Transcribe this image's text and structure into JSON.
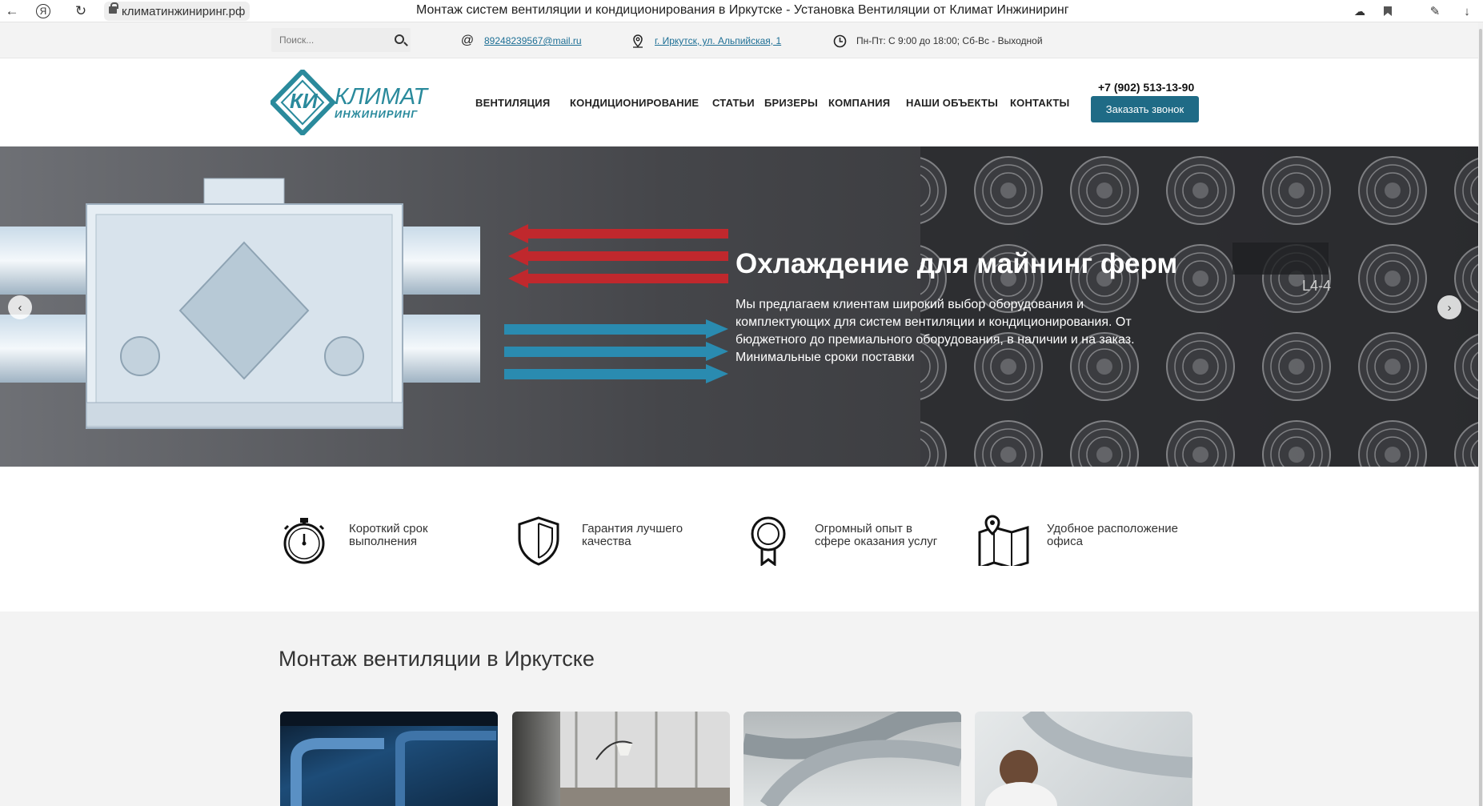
{
  "browser": {
    "url": "климатинжиниринг.рф",
    "title": "Монтаж систем вентиляции и кондиционирования в Иркутске - Установка Вентиляции от Климат Инжиниринг"
  },
  "topbar": {
    "search_placeholder": "Поиск...",
    "email": "89248239567@mail.ru",
    "address": "г. Иркутск, ул. Альпийская, 1",
    "hours": "Пн-Пт: С 9:00 до 18:00; Сб-Вс - Выходной"
  },
  "header": {
    "logo_word1": "КЛИМАТ",
    "logo_word2": "ИНЖИНИРИНГ",
    "logo_letters": "КИ",
    "nav": [
      "ВЕНТИЛЯЦИЯ",
      "КОНДИЦИОНИРОВАНИЕ",
      "СТАТЬИ",
      "БРИЗЕРЫ",
      "КОМПАНИЯ",
      "НАШИ ОБЪЕКТЫ",
      "КОНТАКТЫ"
    ],
    "phone": "+7 (902) 513-13-90",
    "call_button": "Заказать звонок"
  },
  "hero": {
    "title": "Охлаждение для майнинг ферм",
    "text": "Мы предлагаем клиентам широкий выбор оборудования и комплектующих для систем вентиляции и кондиционирования. От бюджетного до премиального оборудования, в наличии и на заказ. Минимальные сроки поставки",
    "panel_label": "L4-4",
    "prev_icon": "chevron-left-icon",
    "next_icon": "chevron-right-icon"
  },
  "features": [
    {
      "icon": "stopwatch-icon",
      "line1": "Короткий срок",
      "line2": "выполнения"
    },
    {
      "icon": "shield-icon",
      "line1": "Гарантия лучшего",
      "line2": "качества"
    },
    {
      "icon": "award-icon",
      "line1": "Огромный опыт в",
      "line2": "сфере оказания услуг"
    },
    {
      "icon": "map-icon",
      "line1": "Удобное расположение",
      "line2": "офиса"
    }
  ],
  "section": {
    "title": "Монтаж вентиляции в Иркутске"
  },
  "colors": {
    "accent": "#1f6b86",
    "link": "#1d6f95",
    "logo": "#2a8a9c",
    "arrow_red": "#c0282d",
    "arrow_blue": "#2a8bb0"
  }
}
